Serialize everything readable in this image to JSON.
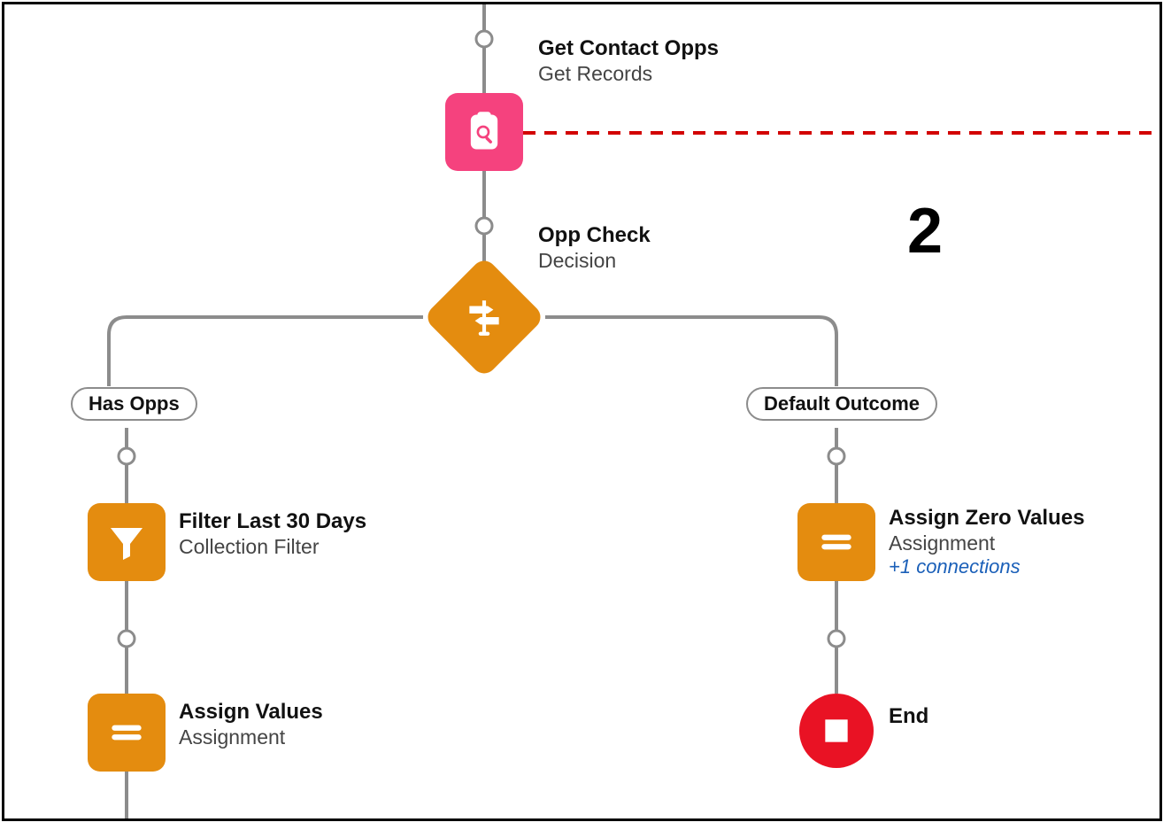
{
  "stepNumber": "2",
  "outcomes": {
    "left": "Has Opps",
    "right": "Default Outcome"
  },
  "nodes": {
    "getContactOpps": {
      "title": "Get Contact Opps",
      "subtitle": "Get Records"
    },
    "oppCheck": {
      "title": "Opp Check",
      "subtitle": "Decision"
    },
    "filterLast30": {
      "title": "Filter Last 30 Days",
      "subtitle": "Collection Filter"
    },
    "assignValues": {
      "title": "Assign Values",
      "subtitle": "Assignment"
    },
    "assignZero": {
      "title": "Assign Zero Values",
      "subtitle": "Assignment",
      "extra": "+1 connections"
    },
    "end": {
      "title": "End"
    }
  }
}
